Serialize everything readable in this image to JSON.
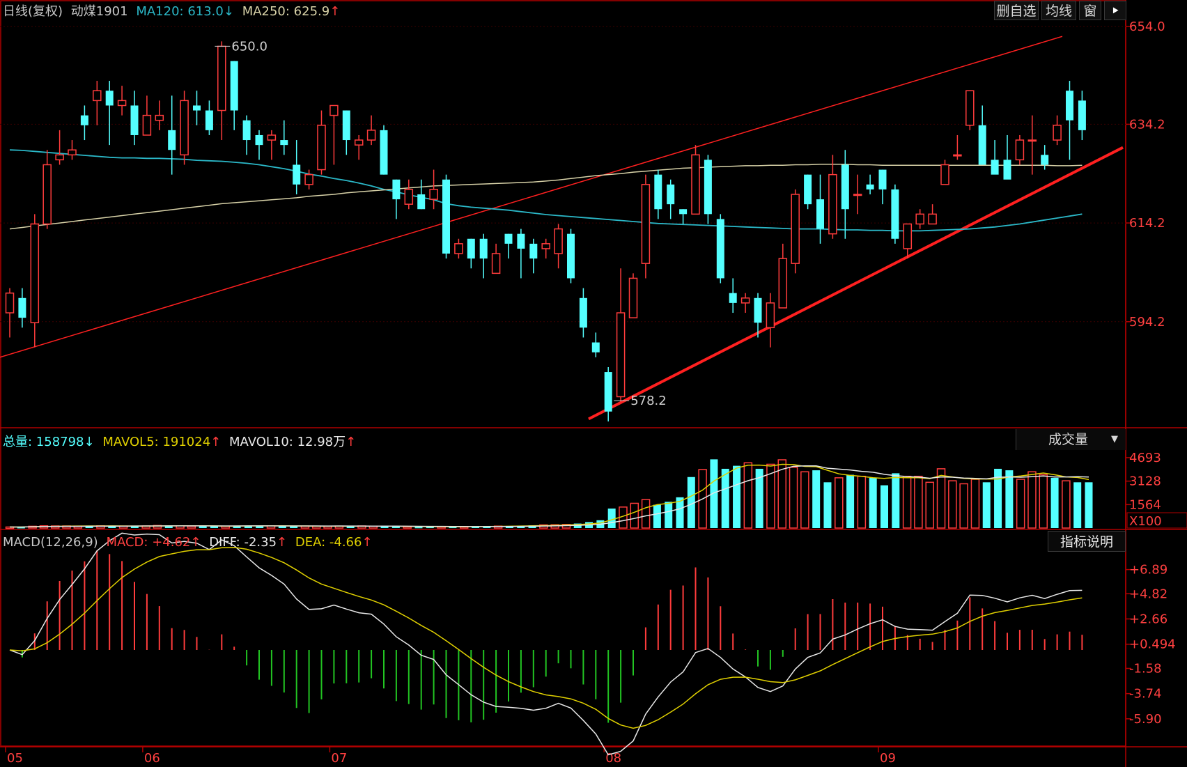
{
  "colors": {
    "up": "#ff3c3c",
    "down": "#54ffff",
    "ma120": "#2bb8c8",
    "ma250": "#d8d2a8",
    "trend": "#ff2020",
    "axis": "#b00000",
    "axis_text": "#ff4040",
    "white_line": "#e8e8e8",
    "yellow_line": "#e0d000",
    "macd_down": "#22c422"
  },
  "top_bar": {
    "title": "日线(复权)",
    "name": "动煤1901",
    "ma120_label": "MA120: 613.0",
    "ma120_arrow": "↓",
    "ma250_label": "MA250: 625.9",
    "ma250_arrow": "↑",
    "buttons": [
      "删自选",
      "均线",
      "窗",
      "⯈"
    ]
  },
  "volume_header": {
    "total_label": "总量: 158798",
    "total_arrow": "↓",
    "mavol5_label": "MAVOL5: 191024",
    "mavol5_arrow": "↑",
    "mavol10_label": "MAVOL10: 12.98万",
    "mavol10_arrow": "↑",
    "dropdown_label": "成交量",
    "dropdown_icon": "▼"
  },
  "macd_header": {
    "title": "MACD(12,26,9)",
    "macd_label": "MACD: +4.62",
    "macd_arrow": "↑",
    "diff_label": "DIFF: -2.35",
    "diff_arrow": "↑",
    "dea_label": "DEA: -4.66",
    "dea_arrow": "↑",
    "button_label": "指标说明"
  },
  "chart_data": [
    {
      "type": "candlestick",
      "price_ticks": [
        "654.0",
        "634.2",
        "614.2",
        "594.2"
      ],
      "price_tick_values": [
        654.0,
        634.2,
        614.2,
        594.2
      ],
      "ylim": [
        573.0,
        655.0
      ],
      "annotations": [
        {
          "text": "650.0",
          "x_index": 16,
          "value": 650.0
        },
        {
          "text": "578.2",
          "x_index": 48,
          "value": 578.2
        }
      ],
      "x_labels": [
        {
          "text": "05",
          "index": 0
        },
        {
          "text": "06",
          "index": 11
        },
        {
          "text": "07",
          "index": 26
        },
        {
          "text": "08",
          "index": 48
        },
        {
          "text": "09",
          "index": 70
        }
      ],
      "candles": [
        [
          596,
          600,
          591,
          601
        ],
        [
          599,
          595,
          593,
          601
        ],
        [
          594,
          614,
          589,
          616
        ],
        [
          614,
          626,
          613,
          629
        ],
        [
          627,
          628,
          626,
          633
        ],
        [
          628,
          629,
          627,
          631
        ],
        [
          636,
          634,
          631,
          638
        ],
        [
          639,
          641,
          634,
          643
        ],
        [
          641,
          638,
          630,
          643
        ],
        [
          638,
          639,
          636,
          642
        ],
        [
          638,
          632,
          630,
          641
        ],
        [
          632,
          636,
          632,
          640
        ],
        [
          635,
          636,
          633,
          639
        ],
        [
          633,
          629,
          624,
          640
        ],
        [
          628,
          639,
          626,
          641
        ],
        [
          638,
          637,
          634,
          641
        ],
        [
          637,
          633,
          632,
          639
        ],
        [
          637,
          650,
          631,
          651
        ],
        [
          647,
          637,
          633,
          647
        ],
        [
          635,
          631,
          628,
          636
        ],
        [
          632,
          630,
          627,
          633
        ],
        [
          631,
          632,
          627,
          633
        ],
        [
          631,
          630,
          628,
          635
        ],
        [
          626,
          622,
          620,
          631
        ],
        [
          622,
          624,
          621,
          625
        ],
        [
          625,
          634,
          624,
          637
        ],
        [
          636,
          638,
          626,
          638
        ],
        [
          637,
          631,
          628,
          637
        ],
        [
          630,
          631,
          627,
          632
        ],
        [
          631,
          633,
          630,
          636
        ],
        [
          633,
          624,
          624,
          634
        ],
        [
          623,
          619,
          615,
          623
        ],
        [
          618,
          621,
          617,
          623
        ],
        [
          620,
          617,
          617,
          623
        ],
        [
          619,
          621,
          617,
          625
        ],
        [
          623,
          608,
          607,
          624
        ],
        [
          608,
          610,
          607,
          611
        ],
        [
          611,
          607,
          605,
          611
        ],
        [
          611,
          607,
          603,
          612
        ],
        [
          604,
          608,
          604,
          610
        ],
        [
          612,
          610,
          607,
          612
        ],
        [
          612,
          609,
          603,
          613
        ],
        [
          610,
          607,
          604,
          611
        ],
        [
          609,
          610,
          607,
          611
        ],
        [
          608,
          613,
          605,
          614
        ],
        [
          612,
          603,
          602,
          613
        ],
        [
          599,
          593,
          591,
          601
        ],
        [
          590,
          588,
          587,
          592
        ],
        [
          584,
          576,
          574,
          585
        ],
        [
          579,
          596,
          578,
          605
        ],
        [
          595,
          603,
          597,
          604
        ],
        [
          606,
          622,
          603,
          624
        ],
        [
          624,
          617,
          615,
          625
        ],
        [
          622,
          618,
          615,
          623
        ],
        [
          617,
          616,
          614,
          617
        ],
        [
          616,
          628,
          616,
          630
        ],
        [
          627,
          616,
          614,
          628
        ],
        [
          615,
          603,
          602,
          616
        ],
        [
          600,
          598,
          596,
          603
        ],
        [
          598,
          599,
          596,
          600
        ],
        [
          599,
          594,
          591,
          600
        ],
        [
          593,
          598,
          589,
          600
        ],
        [
          597,
          607,
          599,
          610
        ],
        [
          606,
          620,
          604,
          621
        ],
        [
          624,
          618,
          617,
          624
        ],
        [
          619,
          613,
          610,
          624
        ],
        [
          612,
          624,
          611,
          628
        ],
        [
          626,
          617,
          611,
          629
        ],
        [
          620,
          620,
          616,
          624
        ],
        [
          622,
          621,
          620,
          624
        ],
        [
          625,
          621,
          618,
          625
        ],
        [
          621,
          611,
          610,
          622
        ],
        [
          609,
          614,
          607,
          614
        ],
        [
          614,
          616,
          613,
          617
        ],
        [
          614,
          616,
          614,
          618
        ],
        [
          622,
          626,
          622,
          627
        ],
        [
          628,
          628,
          627,
          632
        ],
        [
          634,
          641,
          633,
          641
        ],
        [
          634,
          626,
          626,
          638
        ],
        [
          627,
          624,
          625,
          631
        ],
        [
          627,
          623,
          627,
          632
        ],
        [
          627,
          631,
          626,
          632
        ],
        [
          631,
          631,
          624,
          636
        ],
        [
          628,
          626,
          625,
          630
        ],
        [
          631,
          634,
          630,
          636
        ],
        [
          641,
          635,
          627,
          643
        ],
        [
          639,
          633,
          631,
          641
        ]
      ],
      "ma120": [
        629.0,
        628.9,
        628.7,
        628.5,
        628.3,
        628.1,
        627.9,
        627.7,
        627.5,
        627.4,
        627.4,
        627.3,
        627.3,
        627.2,
        627.1,
        626.9,
        626.8,
        626.7,
        626.5,
        626.3,
        626.0,
        625.6,
        625.2,
        624.7,
        624.1,
        623.7,
        623.2,
        622.8,
        622.3,
        621.7,
        621.0,
        620.5,
        619.9,
        619.4,
        618.9,
        618.1,
        617.7,
        617.4,
        617.2,
        617.0,
        616.8,
        616.5,
        616.2,
        615.9,
        615.7,
        615.5,
        615.3,
        615.1,
        614.9,
        614.7,
        614.5,
        614.3,
        614.1,
        614.0,
        613.9,
        613.8,
        613.7,
        613.6,
        613.5,
        613.4,
        613.3,
        613.2,
        613.1,
        613.0,
        613.0,
        613.0,
        612.9,
        612.8,
        612.8,
        612.7,
        612.7,
        612.6,
        612.6,
        612.6,
        612.7,
        612.8,
        612.9,
        613.0,
        613.2,
        613.4,
        613.7,
        614.0,
        614.4,
        614.8,
        615.2,
        615.6,
        616.0
      ],
      "ma250": [
        613.0,
        613.3,
        613.6,
        613.9,
        614.2,
        614.5,
        614.8,
        615.1,
        615.4,
        615.7,
        616.0,
        616.3,
        616.6,
        616.9,
        617.2,
        617.5,
        617.8,
        618.1,
        618.3,
        618.5,
        618.7,
        618.9,
        619.1,
        619.3,
        619.6,
        619.8,
        620.0,
        620.3,
        620.5,
        620.7,
        620.9,
        621.1,
        621.3,
        621.5,
        621.7,
        621.8,
        621.9,
        622.0,
        622.1,
        622.2,
        622.3,
        622.4,
        622.5,
        622.7,
        622.9,
        623.2,
        623.5,
        623.8,
        624.0,
        624.2,
        624.5,
        624.7,
        624.9,
        625.1,
        625.3,
        625.4,
        625.5,
        625.6,
        625.7,
        625.8,
        625.8,
        625.9,
        625.9,
        626.0,
        626.0,
        626.1,
        626.1,
        626.1,
        626.0,
        626.0,
        625.9,
        625.9,
        625.9,
        625.9,
        625.9,
        625.9,
        625.9,
        625.9,
        625.9,
        625.9,
        625.9,
        625.9,
        625.9,
        625.9,
        625.8,
        625.8,
        625.9
      ]
    },
    {
      "type": "bar",
      "name": "volume",
      "ticks": [
        "4693",
        "3128",
        "1564",
        "X100"
      ],
      "tick_values": [
        4693,
        3128,
        1564
      ],
      "ylim": [
        0,
        5200
      ],
      "volume": [
        70,
        70,
        120,
        150,
        140,
        140,
        130,
        140,
        150,
        150,
        130,
        110,
        140,
        170,
        170,
        150,
        120,
        130,
        140,
        120,
        160,
        140,
        160,
        150,
        130,
        120,
        130,
        130,
        120,
        130,
        140,
        140,
        120,
        110,
        100,
        90,
        80,
        90,
        100,
        90,
        90,
        110,
        130,
        130,
        140,
        160,
        180,
        210,
        220,
        240,
        300,
        400,
        520,
        1300,
        1400,
        1650,
        1900,
        1550,
        1750,
        2050,
        3400,
        3900,
        4580,
        3950,
        4150,
        4350,
        3950,
        4250,
        4550,
        4050,
        3750,
        3850,
        3050,
        3350,
        3550,
        3450,
        3350,
        2850,
        3650,
        3450,
        3450,
        3050,
        3950,
        3150,
        2950,
        3250,
        3050,
        3950,
        3850,
        3250,
        3750,
        3550,
        3350,
        3150,
        3050,
        3050
      ],
      "mavol5": [],
      "mavol10": []
    },
    {
      "type": "bar",
      "name": "macd",
      "ticks": [
        "+6.89",
        "+4.82",
        "+2.66",
        "+0.494",
        "-1.58",
        "-3.74",
        "-5.90"
      ],
      "tick_values": [
        6.89,
        4.82,
        2.66,
        0.494,
        -1.58,
        -3.74,
        -5.9
      ],
      "ylim": [
        -8.3,
        8.3
      ]
    }
  ]
}
